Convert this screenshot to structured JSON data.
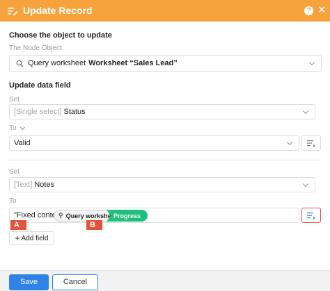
{
  "header": {
    "title": "Update Record",
    "icon": "edit-list-icon",
    "help_icon": "question-icon",
    "help_glyph": "?",
    "close_glyph": "✕",
    "background": "#f7a33d"
  },
  "choose_object": {
    "title": "Choose the object to update",
    "node_label": "The Node Object",
    "selected_prefix": "Query worksheet",
    "selected_bold": "Worksheet “Sales Lead”"
  },
  "update_data": {
    "title": "Update data field",
    "rules": [
      {
        "set_label": "Set",
        "field_type": "[Single select]",
        "field_name": "Status",
        "to_label": "To",
        "value": "Valid"
      },
      {
        "set_label": "Set",
        "field_type": "[Text]",
        "field_name": "Notes",
        "to_label": "To",
        "value_parts": {
          "fixed": "\"Fixed content\"",
          "query": "Query worksheet",
          "field": "Progress"
        }
      }
    ],
    "add_field_label": "Add field",
    "add_field_glyph": "+"
  },
  "markers": {
    "a": "A",
    "b": "B",
    "color": "#e5533b"
  },
  "footer": {
    "save_label": "Save",
    "cancel_label": "Cancel"
  },
  "colors": {
    "accent": "#2f82e6",
    "success": "#1fbf7d"
  }
}
